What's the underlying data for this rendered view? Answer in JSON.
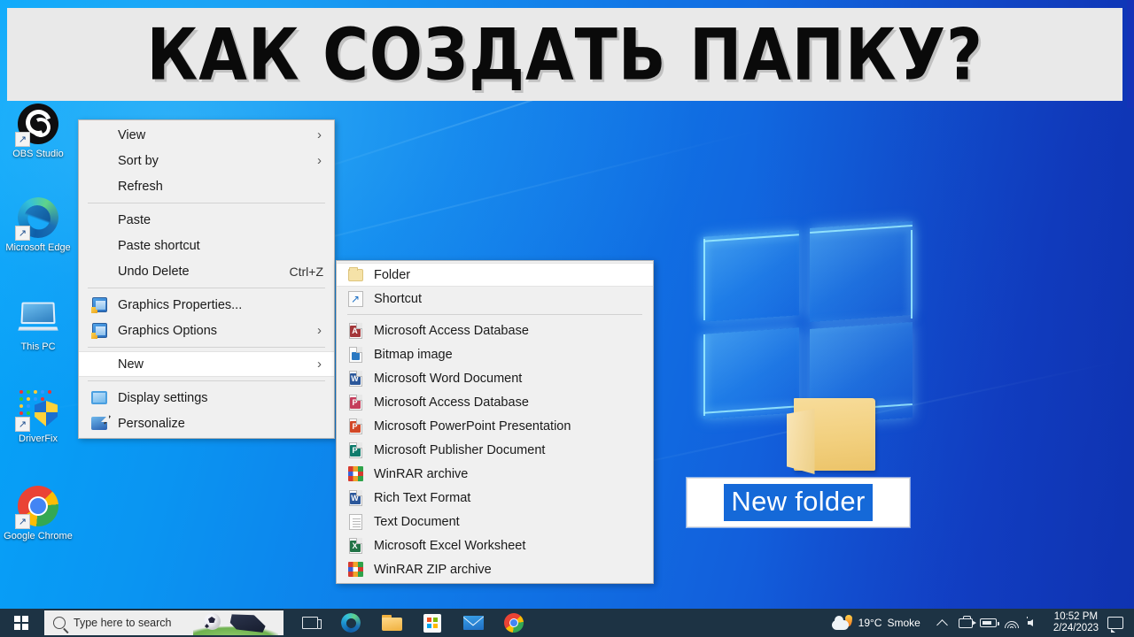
{
  "banner": {
    "text": "КАК СОЗДАТЬ ПАПКУ?",
    "bg_color": "#e9e9e9",
    "text_color": "#0a0a0a"
  },
  "desktop": {
    "wallpaper_accent": "#0a8cf0",
    "icons": [
      {
        "name": "obs-studio",
        "label": "OBS Studio",
        "shortcut": true
      },
      {
        "name": "microsoft-edge",
        "label": "Microsoft Edge",
        "shortcut": true
      },
      {
        "name": "this-pc",
        "label": "This PC",
        "shortcut": false
      },
      {
        "name": "driverfix",
        "label": "DriverFix",
        "shortcut": true
      },
      {
        "name": "google-chrome",
        "label": "Google Chrome",
        "shortcut": true
      }
    ],
    "new_folder": {
      "name_value": "New folder",
      "selection_color": "#1569d8",
      "folder_color": "#f2d07f"
    }
  },
  "context_menu": {
    "items": [
      {
        "label": "View",
        "icon": "",
        "submenu": true,
        "accel": "",
        "highlighted": false,
        "separator_after": false
      },
      {
        "label": "Sort by",
        "icon": "",
        "submenu": true,
        "accel": "",
        "highlighted": false,
        "separator_after": false
      },
      {
        "label": "Refresh",
        "icon": "",
        "submenu": false,
        "accel": "",
        "highlighted": false,
        "separator_after": true
      },
      {
        "label": "Paste",
        "icon": "",
        "submenu": false,
        "accel": "",
        "highlighted": false,
        "separator_after": false
      },
      {
        "label": "Paste shortcut",
        "icon": "",
        "submenu": false,
        "accel": "",
        "highlighted": false,
        "separator_after": false
      },
      {
        "label": "Undo Delete",
        "icon": "",
        "submenu": false,
        "accel": "Ctrl+Z",
        "highlighted": false,
        "separator_after": true
      },
      {
        "label": "Graphics Properties...",
        "icon": "graphics-icon",
        "submenu": false,
        "accel": "",
        "highlighted": false,
        "separator_after": false
      },
      {
        "label": "Graphics Options",
        "icon": "graphics-icon",
        "submenu": true,
        "accel": "",
        "highlighted": false,
        "separator_after": true
      },
      {
        "label": "New",
        "icon": "",
        "submenu": true,
        "accel": "",
        "highlighted": true,
        "separator_after": true
      },
      {
        "label": "Display settings",
        "icon": "display-icon",
        "submenu": false,
        "accel": "",
        "highlighted": false,
        "separator_after": false
      },
      {
        "label": "Personalize",
        "icon": "personalize-icon",
        "submenu": false,
        "accel": "",
        "highlighted": false,
        "separator_after": false
      }
    ]
  },
  "new_submenu": {
    "items": [
      {
        "label": "Folder",
        "icon": "folder-icon",
        "highlighted": true,
        "separator_after": false
      },
      {
        "label": "Shortcut",
        "icon": "shortcut-icon",
        "highlighted": false,
        "separator_after": true
      },
      {
        "label": "Microsoft Access Database",
        "icon": "access-icon",
        "highlighted": false,
        "separator_after": false
      },
      {
        "label": "Bitmap image",
        "icon": "bitmap-icon",
        "highlighted": false,
        "separator_after": false
      },
      {
        "label": "Microsoft Word Document",
        "icon": "word-icon",
        "highlighted": false,
        "separator_after": false
      },
      {
        "label": "Microsoft Access Database",
        "icon": "access-alt-icon",
        "highlighted": false,
        "separator_after": false
      },
      {
        "label": "Microsoft PowerPoint Presentation",
        "icon": "powerpoint-icon",
        "highlighted": false,
        "separator_after": false
      },
      {
        "label": "Microsoft Publisher Document",
        "icon": "publisher-icon",
        "highlighted": false,
        "separator_after": false
      },
      {
        "label": "WinRAR archive",
        "icon": "winrar-icon",
        "highlighted": false,
        "separator_after": false
      },
      {
        "label": "Rich Text Format",
        "icon": "rtf-icon",
        "highlighted": false,
        "separator_after": false
      },
      {
        "label": "Text Document",
        "icon": "text-icon",
        "highlighted": false,
        "separator_after": false
      },
      {
        "label": "Microsoft Excel Worksheet",
        "icon": "excel-icon",
        "highlighted": false,
        "separator_after": false
      },
      {
        "label": "WinRAR ZIP archive",
        "icon": "winrar-zip-icon",
        "highlighted": false,
        "separator_after": false
      }
    ]
  },
  "taskbar": {
    "bg_color": "#1d3344",
    "search_placeholder": "Type here to search",
    "pinned": [
      {
        "name": "task-view",
        "label": "Task View"
      },
      {
        "name": "microsoft-edge",
        "label": "Microsoft Edge"
      },
      {
        "name": "file-explorer",
        "label": "File Explorer"
      },
      {
        "name": "microsoft-store",
        "label": "Microsoft Store"
      },
      {
        "name": "mail",
        "label": "Mail"
      },
      {
        "name": "google-chrome",
        "label": "Google Chrome"
      }
    ],
    "tray": {
      "weather_temp": "19°C",
      "weather_condition": "Smoke",
      "time": "10:52 PM",
      "date": "2/24/2023"
    }
  }
}
